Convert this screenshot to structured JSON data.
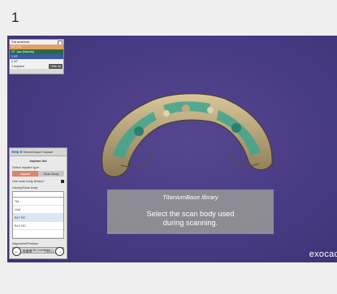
{
  "step": {
    "number": "1"
  },
  "mini_panel": {
    "rows": [
      {
        "label": "Full anatomic",
        "style": "light"
      },
      {
        "label": "ST / ST",
        "style": "orange"
      },
      {
        "label": "ST Jaw (Maxilla)",
        "style": "green"
      },
      {
        "label": "1 ST",
        "style": "blue"
      },
      {
        "label": "2 ST",
        "style": "light"
      },
      {
        "label": "1 Implant",
        "style": "light",
        "button": "Hide all"
      }
    ]
  },
  "wizard": {
    "header_step": "Step 8",
    "header_title": "Select/Import Implant",
    "title": "Implant list",
    "type_label": "Select implant type",
    "toggle_left": "Implant",
    "toggle_right": "Scan Body",
    "checkbox_label": "Use scan body library?",
    "library_label": "Library/Scan body",
    "library_value": "",
    "list_items": [
      "Ti4 ...",
      "Unit",
      "BLT RC",
      "BLX RC",
      ""
    ],
    "selected_index": 2,
    "slider_label": "Alignment/Position",
    "wide_button": "Auto fit / continue",
    "back_label": "Back",
    "next_label": "Next"
  },
  "overlay": {
    "title": "TitaniumBase library",
    "message": "Select the scan body used\nduring scanning."
  },
  "brand": {
    "text": "exocad"
  },
  "colors": {
    "viewport_bg": "#4a3d86",
    "accent_orange": "#d9866b",
    "model_teal": "#3fa58f",
    "model_tan": "#c9b38a"
  }
}
